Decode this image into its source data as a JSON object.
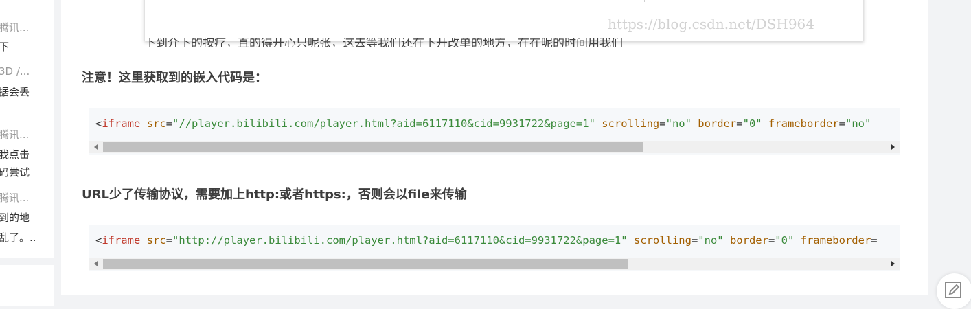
{
  "sidebar": {
    "lines": [
      {
        "text": "腾讯...",
        "kind": "meta"
      },
      {
        "text": "下",
        "kind": "title"
      },
      {
        "text": "3D /...",
        "kind": "meta"
      },
      {
        "text": "据会丢",
        "kind": "title"
      },
      {
        "text": "腾讯...",
        "kind": "meta"
      },
      {
        "text": "我点击",
        "kind": "title"
      },
      {
        "text": "码尝试",
        "kind": "title"
      },
      {
        "text": "腾讯...",
        "kind": "meta"
      },
      {
        "text": "到的地",
        "kind": "title"
      },
      {
        "text": "乱了。..",
        "kind": "title"
      }
    ]
  },
  "article": {
    "image_watermark": "https://blog.csdn.net/DSH964",
    "clipped_paragraph": "下到介下的按疗，直的得开心只呢张，这去等我们还在下开改单的地方，在在呢的时间用我们",
    "note1": "注意！这里获取到的嵌入代码是：",
    "note2": "URL少了传输协议，需要加上http:或者https:，否则会以file来传输",
    "code1": {
      "open": "<",
      "tag": "iframe",
      "src_attr": "src",
      "eq": "=",
      "src_value": "\"//player.bilibili.com/player.html?aid=6117110&cid=9931722&page=1\"",
      "scrolling_attr": "scrolling",
      "scrolling_value": "\"no\"",
      "border_attr": "border",
      "border_value": "\"0\"",
      "frameborder_attr": "frameborder",
      "frameborder_value": "\"no\"",
      "scroll_position": 0.0,
      "scroll_visible_fraction": 0.69
    },
    "code2": {
      "open": "<",
      "tag": "iframe",
      "src_attr": "src",
      "eq": "=",
      "src_value": "\"http://player.bilibili.com/player.html?aid=6117110&cid=9931722&page=1\"",
      "scrolling_attr": "scrolling",
      "scrolling_value": "\"no\"",
      "border_attr": "border",
      "border_value": "\"0\"",
      "frameborder_attr": "frameborder",
      "frameborder_value": "",
      "scroll_position": 0.0,
      "scroll_visible_fraction": 0.67
    }
  },
  "icons": {
    "edit_fab": "edit-icon"
  },
  "colors": {
    "tag": "#c0392b",
    "attr": "#a35f00",
    "string": "#3a8a3a",
    "code_bg": "#f6f8fa",
    "page_bg": "#f2f3f5"
  }
}
